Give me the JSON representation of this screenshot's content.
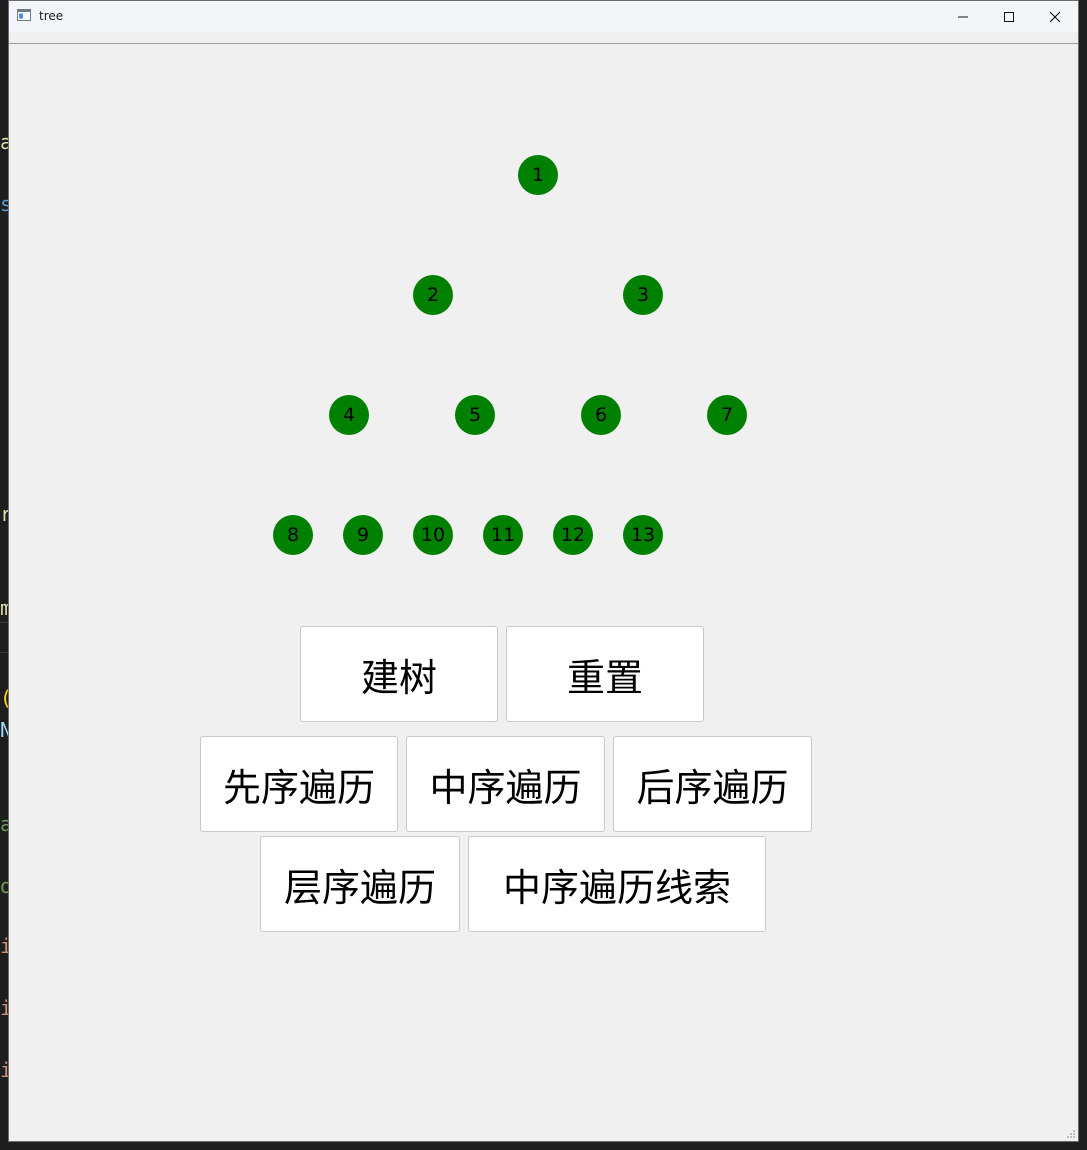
{
  "window": {
    "title": "tree"
  },
  "tree": {
    "nodes": [
      "1",
      "2",
      "3",
      "4",
      "5",
      "6",
      "7",
      "8",
      "9",
      "10",
      "11",
      "12",
      "13"
    ],
    "node_color": "#008000"
  },
  "buttons": {
    "build": "建树",
    "reset": "重置",
    "preorder": "先序遍历",
    "inorder": "中序遍历",
    "postorder": "后序遍历",
    "levelorder": "层序遍历",
    "inorder_thread": "中序遍历线索"
  },
  "background_fragments": [
    "a",
    "s",
    "r",
    "m",
    "(",
    "N",
    "a",
    "o",
    "i",
    "i",
    "i"
  ]
}
